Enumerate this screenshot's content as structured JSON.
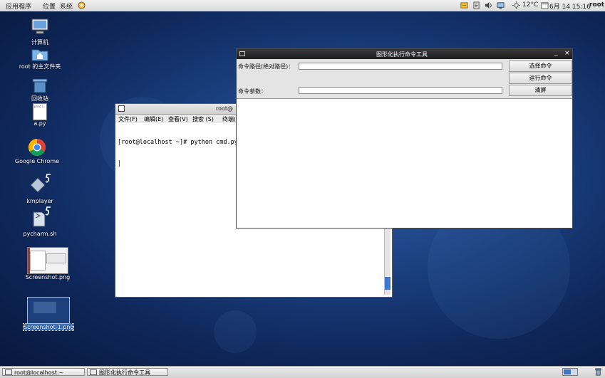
{
  "top_panel": {
    "menu": [
      "应用程序",
      "位置",
      "系统"
    ],
    "weather": "12°C",
    "clock": "6月 14 15:16",
    "user": "root"
  },
  "desktop_icons": [
    {
      "name": "computer-icon",
      "label": "计算机"
    },
    {
      "name": "home-folder-icon",
      "label": "root 的主文件夹"
    },
    {
      "name": "trash-icon",
      "label": "回收站"
    },
    {
      "name": "python-file-icon",
      "label": "a.py",
      "thumb_text": "print 1"
    },
    {
      "name": "chrome-icon",
      "label": "Google Chrome"
    },
    {
      "name": "kmplayer-icon",
      "label": "kmplayer"
    },
    {
      "name": "pycharm-icon",
      "label": "pycharm.sh"
    },
    {
      "name": "screenshot-file-icon",
      "label": "Screenshot.png"
    },
    {
      "name": "screenshot-1-file-icon",
      "label": "Screenshot-1.png"
    }
  ],
  "terminal": {
    "title": "root@",
    "menu": [
      "文件(F)",
      "编辑(E)",
      "查看(V)",
      "搜索 (S)",
      "终端("
    ],
    "line1": "[root@localhost ~]# python cmd.py",
    "cursor": "|"
  },
  "tool_window": {
    "title": "图形化执行命令工具",
    "path_label": "命令路径(绝对路径)：",
    "param_label": "命令参数：",
    "path_value": "",
    "param_value": "",
    "select_button": "选择命令",
    "run_button": "运行命令",
    "clear_button": "清屏",
    "min": "_",
    "close": "×"
  },
  "taskbar": [
    {
      "label": "root@localhost:~"
    },
    {
      "label": "图形化执行命令工具"
    }
  ]
}
